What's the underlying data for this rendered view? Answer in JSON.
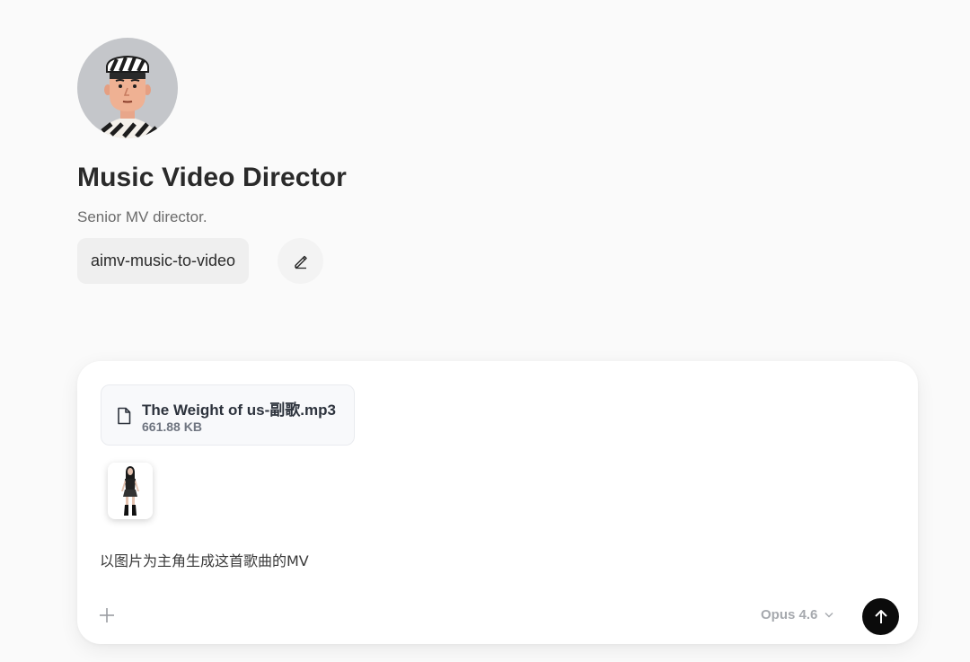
{
  "agent": {
    "name": "Music Video Director",
    "description": "Senior MV director.",
    "skill_chip": "aimv-music-to-video",
    "avatar_icon": "director-avatar"
  },
  "composer": {
    "attachment": {
      "file_name": "The Weight of us-副歌.mp3",
      "file_size": "661.88 KB",
      "icon": "file-icon"
    },
    "image_attachment_icon": "image-thumbnail",
    "prompt": "以图片为主角生成这首歌曲的MV",
    "model": "Opus 4.6",
    "add_icon": "plus-icon",
    "send_icon": "arrow-up-icon"
  }
}
